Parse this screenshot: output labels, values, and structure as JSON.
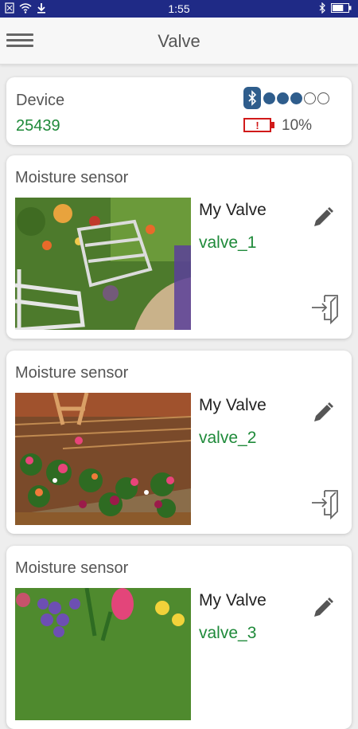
{
  "statusbar": {
    "time": "1:55",
    "battery_level": 0.7
  },
  "appbar": {
    "title": "Valve"
  },
  "device": {
    "label": "Device",
    "id": "25439",
    "signal_strength": 3,
    "signal_max": 5,
    "battery_percent": "10%"
  },
  "valves": [
    {
      "title": "Moisture sensor",
      "name": "My Valve",
      "id": "valve_1"
    },
    {
      "title": "Moisture sensor",
      "name": "My Valve",
      "id": "valve_2"
    },
    {
      "title": "Moisture sensor",
      "name": "My Valve",
      "id": "valve_3"
    }
  ],
  "colors": {
    "statusbar": "#1f2a86",
    "accent_green": "#1f8a3a",
    "bluetooth_blue": "#2f5d8c",
    "battery_red": "#d11a1a"
  }
}
